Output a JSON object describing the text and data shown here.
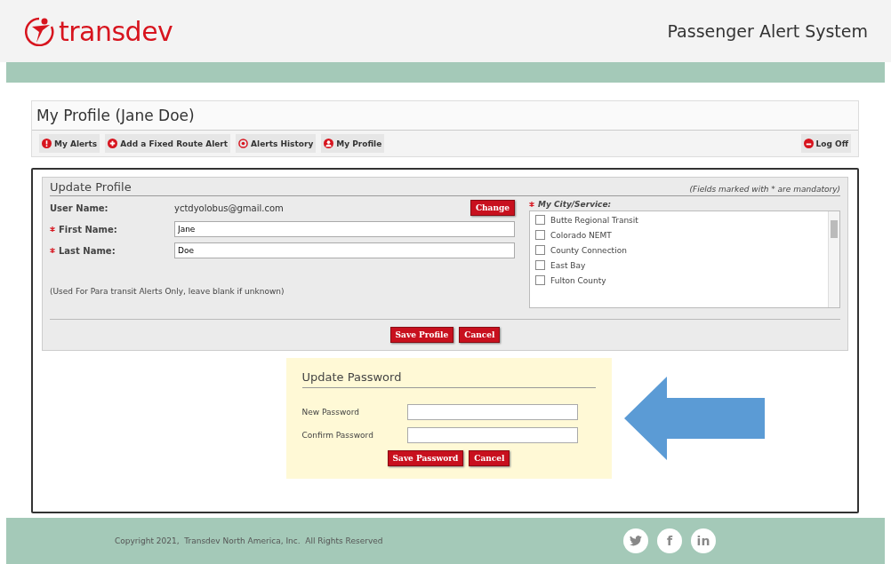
{
  "header": {
    "logo_text": "transdev",
    "title": "Passenger Alert System"
  },
  "profile_header": {
    "title": "My Profile (Jane Doe)"
  },
  "nav": [
    {
      "label": "My Alerts",
      "kind": "alert"
    },
    {
      "label": "Add a Fixed Route Alert",
      "kind": "plus"
    },
    {
      "label": "Alerts History",
      "kind": "history"
    },
    {
      "label": "My Profile",
      "kind": "user"
    }
  ],
  "logoff": {
    "label": "Log Off",
    "kind": "power"
  },
  "update_profile": {
    "title": "Update Profile",
    "note": "(Fields marked with * are mandatory)",
    "user_name_label": "User Name:",
    "user_name": "yctdyolobus@gmail.com",
    "change_button": "Change",
    "fields": [
      {
        "label": "First Name:",
        "value": "Jane",
        "required": true
      },
      {
        "label": "Last Name:",
        "value": "Doe",
        "required": true
      }
    ],
    "hint": "(Used For Para transit Alerts Only, leave blank if unknown)",
    "city_label": "My City/Service:",
    "city_required": true,
    "cities": [
      {
        "label": "Butte Regional Transit",
        "checked": false
      },
      {
        "label": "Colorado NEMT",
        "checked": false
      },
      {
        "label": "County Connection",
        "checked": false
      },
      {
        "label": "East Bay",
        "checked": false
      },
      {
        "label": "Fulton County",
        "checked": false
      }
    ],
    "buttons": [
      "Save Profile",
      "Cancel"
    ]
  },
  "update_password": {
    "title": "Update Password",
    "fields": [
      {
        "label": "New Password"
      },
      {
        "label": "Confirm Password"
      }
    ],
    "buttons": [
      "Save Password",
      "Cancel"
    ]
  },
  "footer": {
    "copyright": "Copyright 2021,  Transdev North America, Inc.  All Rights Reserved",
    "social": [
      {
        "kind": "twitter"
      },
      {
        "kind": "text",
        "label": "f"
      },
      {
        "kind": "text",
        "label": "in"
      }
    ]
  }
}
